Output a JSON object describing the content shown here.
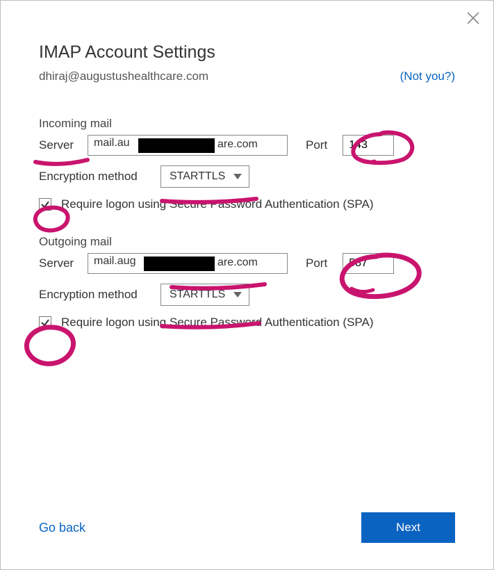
{
  "title": "IMAP Account Settings",
  "email": "dhiraj@augustushealthcare.com",
  "not_you": "(Not you?)",
  "incoming": {
    "heading": "Incoming mail",
    "server_label": "Server",
    "server_value": "mail.au████████████are.com",
    "server_prefix": "mail.au",
    "server_suffix": "are.com",
    "port_label": "Port",
    "port_value": "143",
    "enc_label": "Encryption method",
    "enc_value": "STARTTLS",
    "spa_label": "Require logon using Secure Password Authentication (SPA)",
    "spa_checked": true
  },
  "outgoing": {
    "heading": "Outgoing mail",
    "server_label": "Server",
    "server_value": "mail.aug███████████are.com",
    "server_prefix": "mail.aug",
    "server_suffix": "are.com",
    "port_label": "Port",
    "port_value": "587",
    "enc_label": "Encryption method",
    "enc_value": "STARTTLS",
    "spa_label": "Require logon using Secure Password Authentication (SPA)",
    "spa_checked": true
  },
  "footer": {
    "go_back": "Go back",
    "next": "Next"
  },
  "colors": {
    "accent": "#0a63c1",
    "annotation": "#c9146e"
  }
}
